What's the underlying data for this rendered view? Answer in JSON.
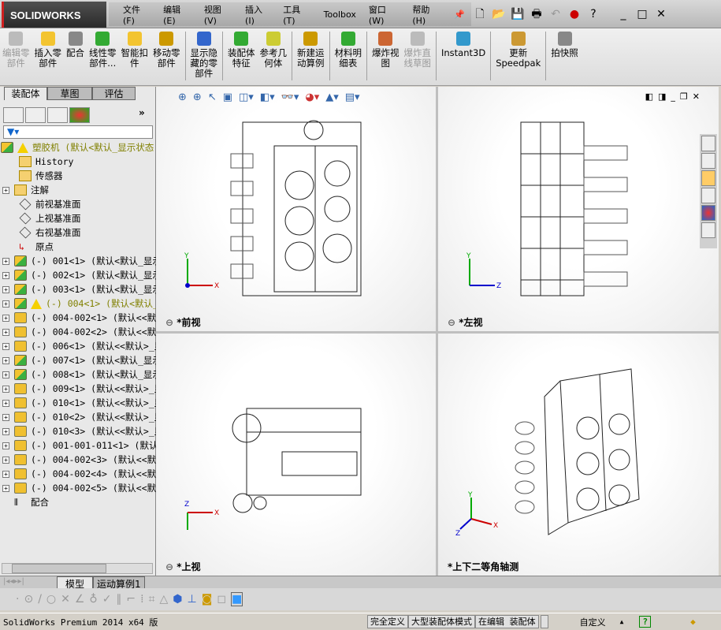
{
  "app": {
    "logo": "SOLIDWORKS"
  },
  "menu": [
    "文件(F)",
    "编辑(E)",
    "视图(V)",
    "插入(I)",
    "工具(T)",
    "Toolbox",
    "窗口(W)",
    "帮助(H)"
  ],
  "commands": [
    {
      "label": "编辑零\n部件",
      "disabled": true
    },
    {
      "label": "插入零\n部件",
      "disabled": false
    },
    {
      "label": "配合",
      "disabled": false
    },
    {
      "label": "线性零\n部件...",
      "disabled": false
    },
    {
      "label": "智能扣\n件",
      "disabled": false
    },
    {
      "label": "移动零\n部件",
      "disabled": false
    },
    {
      "label": "显示隐\n藏的零\n部件",
      "disabled": false
    },
    {
      "label": "装配体\n特征",
      "disabled": false
    },
    {
      "label": "参考几\n何体",
      "disabled": false
    },
    {
      "label": "新建运\n动算例",
      "disabled": false
    },
    {
      "label": "材料明\n细表",
      "disabled": false
    },
    {
      "label": "爆炸视\n图",
      "disabled": false
    },
    {
      "label": "爆炸直\n线草图",
      "disabled": true
    },
    {
      "label": "Instant3D",
      "disabled": false
    },
    {
      "label": "更新\nSpeedpak",
      "disabled": false
    },
    {
      "label": "拍快照",
      "disabled": false
    }
  ],
  "fm_tabs": [
    "装配体",
    "草图",
    "评估"
  ],
  "tree": [
    {
      "label": "塑胶机  (默认<默认_显示状态",
      "type": "asm",
      "warn": true,
      "olive": true,
      "pm": false,
      "indent": 0
    },
    {
      "label": "History",
      "type": "folder",
      "pm": false,
      "indent": 1
    },
    {
      "label": "传感器",
      "type": "folder",
      "pm": false,
      "indent": 1
    },
    {
      "label": "注解",
      "type": "folder",
      "pm": true,
      "indent": 1
    },
    {
      "label": "前视基准面",
      "type": "plane",
      "pm": false,
      "indent": 1
    },
    {
      "label": "上视基准面",
      "type": "plane",
      "pm": false,
      "indent": 1
    },
    {
      "label": "右视基准面",
      "type": "plane",
      "pm": false,
      "indent": 1
    },
    {
      "label": "原点",
      "type": "origin",
      "pm": false,
      "indent": 1
    },
    {
      "label": "(-) 001<1> (默认<默认_显示",
      "type": "asm",
      "pm": true
    },
    {
      "label": "(-) 002<1> (默认<默认_显示",
      "type": "asm",
      "pm": true
    },
    {
      "label": "(-) 003<1> (默认<默认_显示",
      "type": "asm",
      "pm": true
    },
    {
      "label": "(-) 004<1> (默认<默认_显",
      "type": "asm",
      "pm": true,
      "warn": true,
      "olive": true
    },
    {
      "label": "(-) 004-002<1> (默认<<默认",
      "type": "part",
      "pm": true
    },
    {
      "label": "(-) 004-002<2> (默认<<默认",
      "type": "part",
      "pm": true
    },
    {
      "label": "(-) 006<1> (默认<<默认>_显",
      "type": "part",
      "pm": true
    },
    {
      "label": "(-) 007<1> (默认<默认_显示",
      "type": "asm",
      "pm": true
    },
    {
      "label": "(-) 008<1> (默认<默认_显示",
      "type": "asm",
      "pm": true
    },
    {
      "label": "(-) 009<1> (默认<<默认>_显",
      "type": "part",
      "pm": true
    },
    {
      "label": "(-) 010<1> (默认<<默认>_显",
      "type": "part",
      "pm": true
    },
    {
      "label": "(-) 010<2> (默认<<默认>_显",
      "type": "part",
      "pm": true
    },
    {
      "label": "(-) 010<3> (默认<<默认>_显",
      "type": "part",
      "pm": true
    },
    {
      "label": "(-) 001-001-011<1> (默认<<",
      "type": "part",
      "pm": true
    },
    {
      "label": "(-) 004-002<3> (默认<<默认",
      "type": "part",
      "pm": true
    },
    {
      "label": "(-) 004-002<4> (默认<<默认",
      "type": "part",
      "pm": true
    },
    {
      "label": "(-) 004-002<5> (默认<<默认",
      "type": "part",
      "pm": true
    },
    {
      "label": "配合",
      "type": "mate",
      "pm": false
    }
  ],
  "views": {
    "front": "*前视",
    "left": "*左视",
    "top": "*上视",
    "iso": "*上下二等角轴测"
  },
  "bottom_tabs": [
    "模型",
    "运动算例1"
  ],
  "status": {
    "version": "SolidWorks Premium 2014 x64 版",
    "defined": "完全定义",
    "mode": "大型装配体模式",
    "editing": "在编辑 装配体",
    "units": "自定义",
    "help": "?"
  }
}
